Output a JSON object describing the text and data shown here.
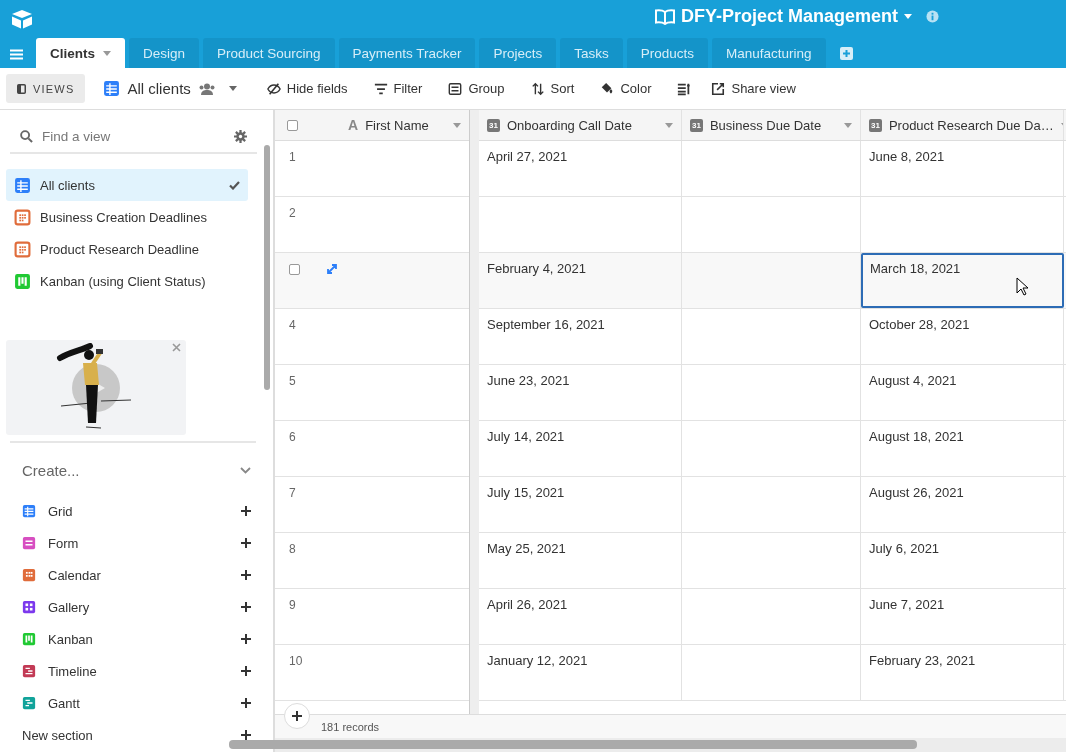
{
  "app": {
    "title": "DFY-Project Management"
  },
  "tabs": [
    {
      "label": "Clients",
      "selected": true
    },
    {
      "label": "Design",
      "selected": false
    },
    {
      "label": "Product Sourcing",
      "selected": false
    },
    {
      "label": "Payments Tracker",
      "selected": false
    },
    {
      "label": "Projects",
      "selected": false
    },
    {
      "label": "Tasks",
      "selected": false
    },
    {
      "label": "Products",
      "selected": false
    },
    {
      "label": "Manufacturing",
      "selected": false
    }
  ],
  "toolbar": {
    "views_label": "VIEWS",
    "current_view": "All clients",
    "actions": [
      {
        "kind": "hide",
        "label": "Hide fields"
      },
      {
        "kind": "filter",
        "label": "Filter"
      },
      {
        "kind": "group",
        "label": "Group"
      },
      {
        "kind": "sort",
        "label": "Sort"
      },
      {
        "kind": "color",
        "label": "Color"
      },
      {
        "kind": "height"
      },
      {
        "kind": "share",
        "label": "Share view"
      }
    ]
  },
  "sidebar": {
    "search": {
      "placeholder": "Find a view"
    },
    "views": [
      {
        "kind": "grid",
        "label": "All clients",
        "selected": true
      },
      {
        "kind": "calendar",
        "label": "Business Creation Deadlines",
        "selected": false
      },
      {
        "kind": "calendar",
        "label": "Product Research Deadline",
        "selected": false
      },
      {
        "kind": "kanban",
        "label": "Kanban (using Client Status)",
        "selected": false
      }
    ],
    "create": {
      "title": "Create...",
      "items": [
        {
          "kind": "grid",
          "label": "Grid"
        },
        {
          "kind": "form",
          "label": "Form"
        },
        {
          "kind": "calendar",
          "label": "Calendar"
        },
        {
          "kind": "gallery",
          "label": "Gallery"
        },
        {
          "kind": "kanban",
          "label": "Kanban"
        },
        {
          "kind": "timeline",
          "label": "Timeline"
        },
        {
          "kind": "gantt",
          "label": "Gantt"
        },
        {
          "kind": "section",
          "label": "New section"
        }
      ]
    }
  },
  "table": {
    "select_all": {
      "checked": false
    },
    "columns": [
      {
        "kind": "text",
        "icon": "A",
        "label": "First Name"
      },
      {
        "kind": "date",
        "icon": "31",
        "label": "Onboarding Call Date"
      },
      {
        "kind": "date",
        "icon": "31",
        "label": "Business Due Date"
      },
      {
        "kind": "date",
        "icon": "31",
        "label": "Product Research Due Da…"
      }
    ],
    "rows": [
      {
        "number": "1",
        "hovered": false,
        "cells": [
          "April 27, 2021",
          "",
          "June 8, 2021"
        ],
        "cell_selected": false
      },
      {
        "number": "2",
        "hovered": false,
        "cells": [
          "",
          "",
          ""
        ],
        "cell_selected": false
      },
      {
        "hovered": true,
        "checked": false,
        "cells": [
          "February 4, 2021",
          "",
          "March 18, 2021"
        ],
        "cell_selected": true
      },
      {
        "number": "4",
        "hovered": false,
        "cells": [
          "September 16, 2021",
          "",
          "October 28, 2021"
        ],
        "cell_selected": false
      },
      {
        "number": "5",
        "hovered": false,
        "cells": [
          "June 23, 2021",
          "",
          "August 4, 2021"
        ],
        "cell_selected": false
      },
      {
        "number": "6",
        "hovered": false,
        "cells": [
          "July 14, 2021",
          "",
          "August 18, 2021"
        ],
        "cell_selected": false
      },
      {
        "number": "7",
        "hovered": false,
        "cells": [
          "July 15, 2021",
          "",
          "August 26, 2021"
        ],
        "cell_selected": false
      },
      {
        "number": "8",
        "hovered": false,
        "cells": [
          "May 25, 2021",
          "",
          "July 6, 2021"
        ],
        "cell_selected": false
      },
      {
        "number": "9",
        "hovered": false,
        "cells": [
          "April 26, 2021",
          "",
          "June 7, 2021"
        ],
        "cell_selected": false
      },
      {
        "number": "10",
        "hovered": false,
        "cells": [
          "January 12, 2021",
          "",
          "February 23, 2021"
        ],
        "cell_selected": false
      }
    ],
    "record_count": "181 records"
  }
}
